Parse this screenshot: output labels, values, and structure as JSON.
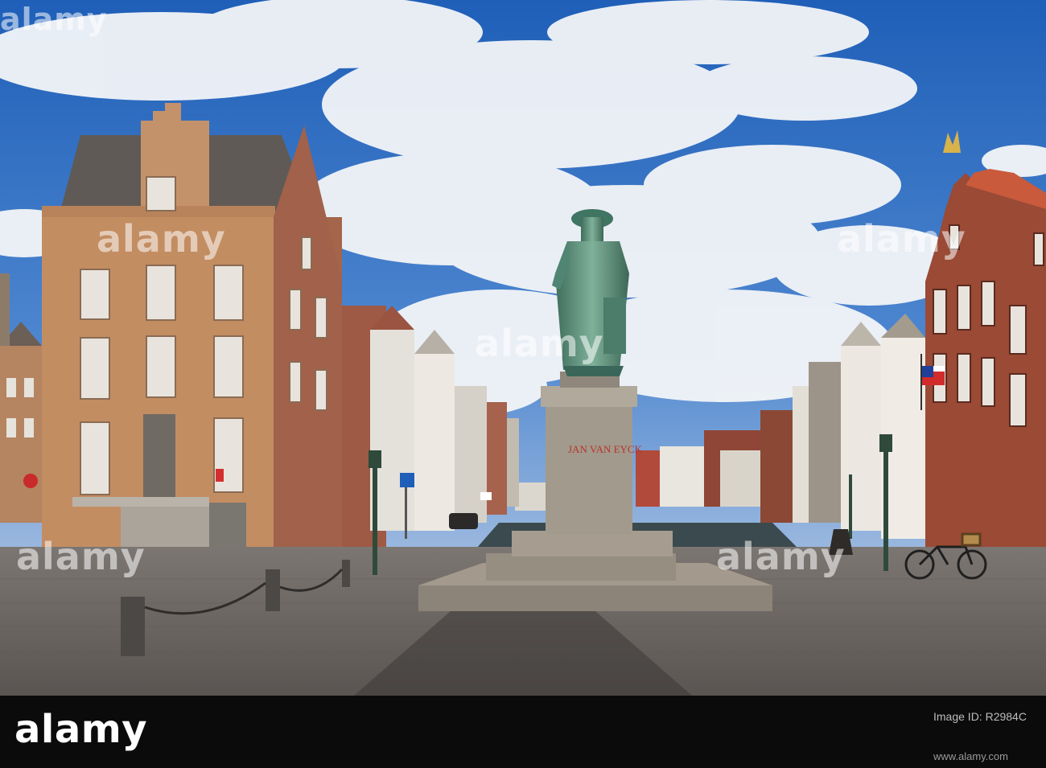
{
  "photo": {
    "statue_inscription": "JAN VAN EYCK",
    "watermark": "alamy",
    "palette": {
      "sky": "#2f6fc4",
      "cloud": "#f4f6f9",
      "brick_light": "#c79466",
      "brick_dark": "#8a4b35",
      "bronze": "#5f8f79",
      "stone": "#9c9284",
      "cobbles": "#6e6a66",
      "water": "#3b4a4f"
    }
  },
  "footer": {
    "brand": "alamy",
    "image_id_label": "Image ID: R2984C",
    "image_id": "R2984C",
    "url": "www.alamy.com"
  }
}
